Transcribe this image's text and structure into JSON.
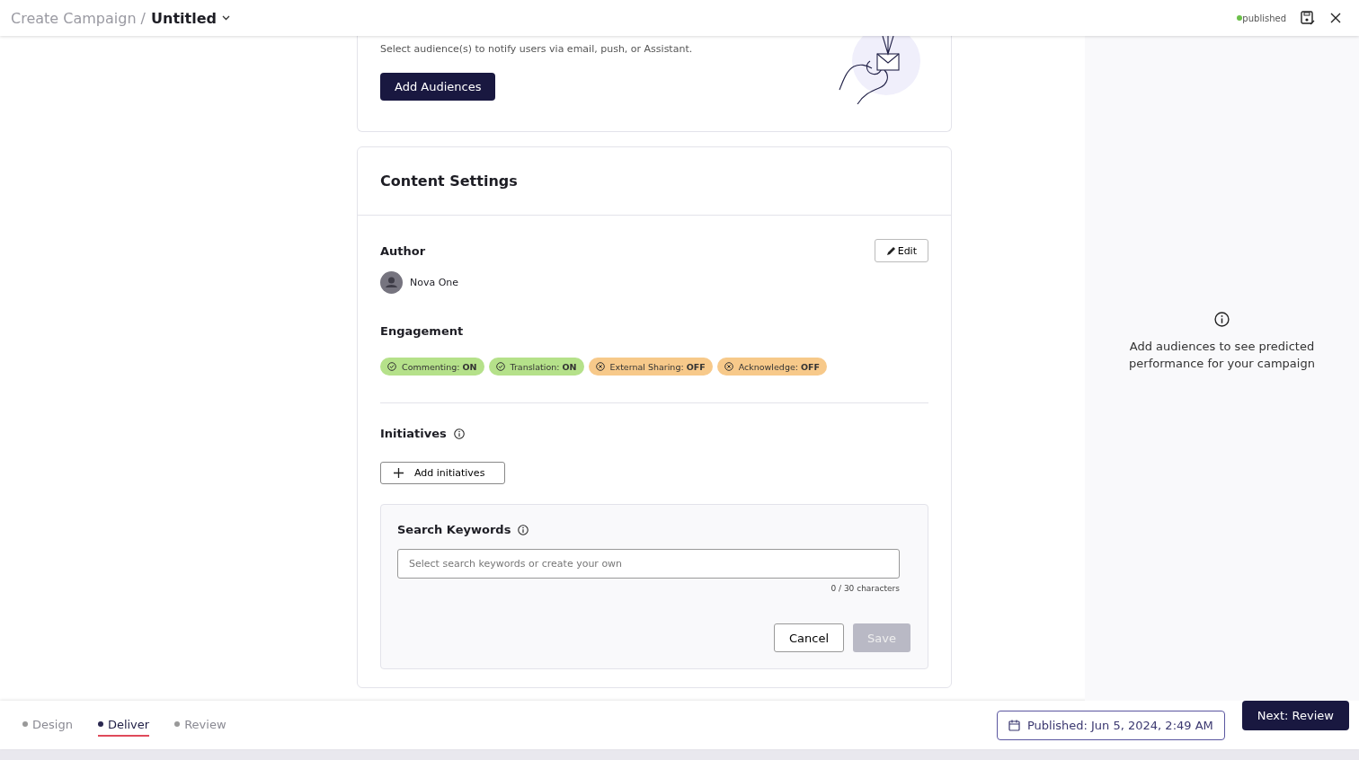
{
  "header": {
    "breadcrumb": "Create Campaign /",
    "title": "Untitled",
    "status": "published"
  },
  "audiences": {
    "description": "Select audience(s) to notify users via email, push, or Assistant.",
    "button": "Add Audiences"
  },
  "content_settings": {
    "title": "Content Settings",
    "author": {
      "label": "Author",
      "edit": "Edit",
      "name": "Nova One"
    },
    "engagement": {
      "label": "Engagement",
      "chips": [
        {
          "text": "Commenting: **ON**",
          "on": true
        },
        {
          "text": "Translation: **ON**",
          "on": true
        },
        {
          "text": "External Sharing: **OFF**",
          "on": false
        },
        {
          "text": "Acknowledge: **OFF**",
          "on": false
        }
      ]
    },
    "initiatives": {
      "label": "Initiatives",
      "button": "Add initiatives"
    },
    "keywords": {
      "label": "Search Keywords",
      "placeholder": "Select search keywords or create your own",
      "counter": "0 / 30 characters",
      "cancel": "Cancel",
      "save": "Save",
      "save_disabled": true
    }
  },
  "side_panel": {
    "message": "Add audiences to see predicted performance for your campaign"
  },
  "footer": {
    "steps": [
      {
        "label": "Design",
        "selected": false
      },
      {
        "label": "Deliver",
        "selected": true
      },
      {
        "label": "Review",
        "selected": false
      }
    ],
    "published": "Published: Jun 5, 2024, 2:49 AM",
    "next": "Next: Review"
  }
}
